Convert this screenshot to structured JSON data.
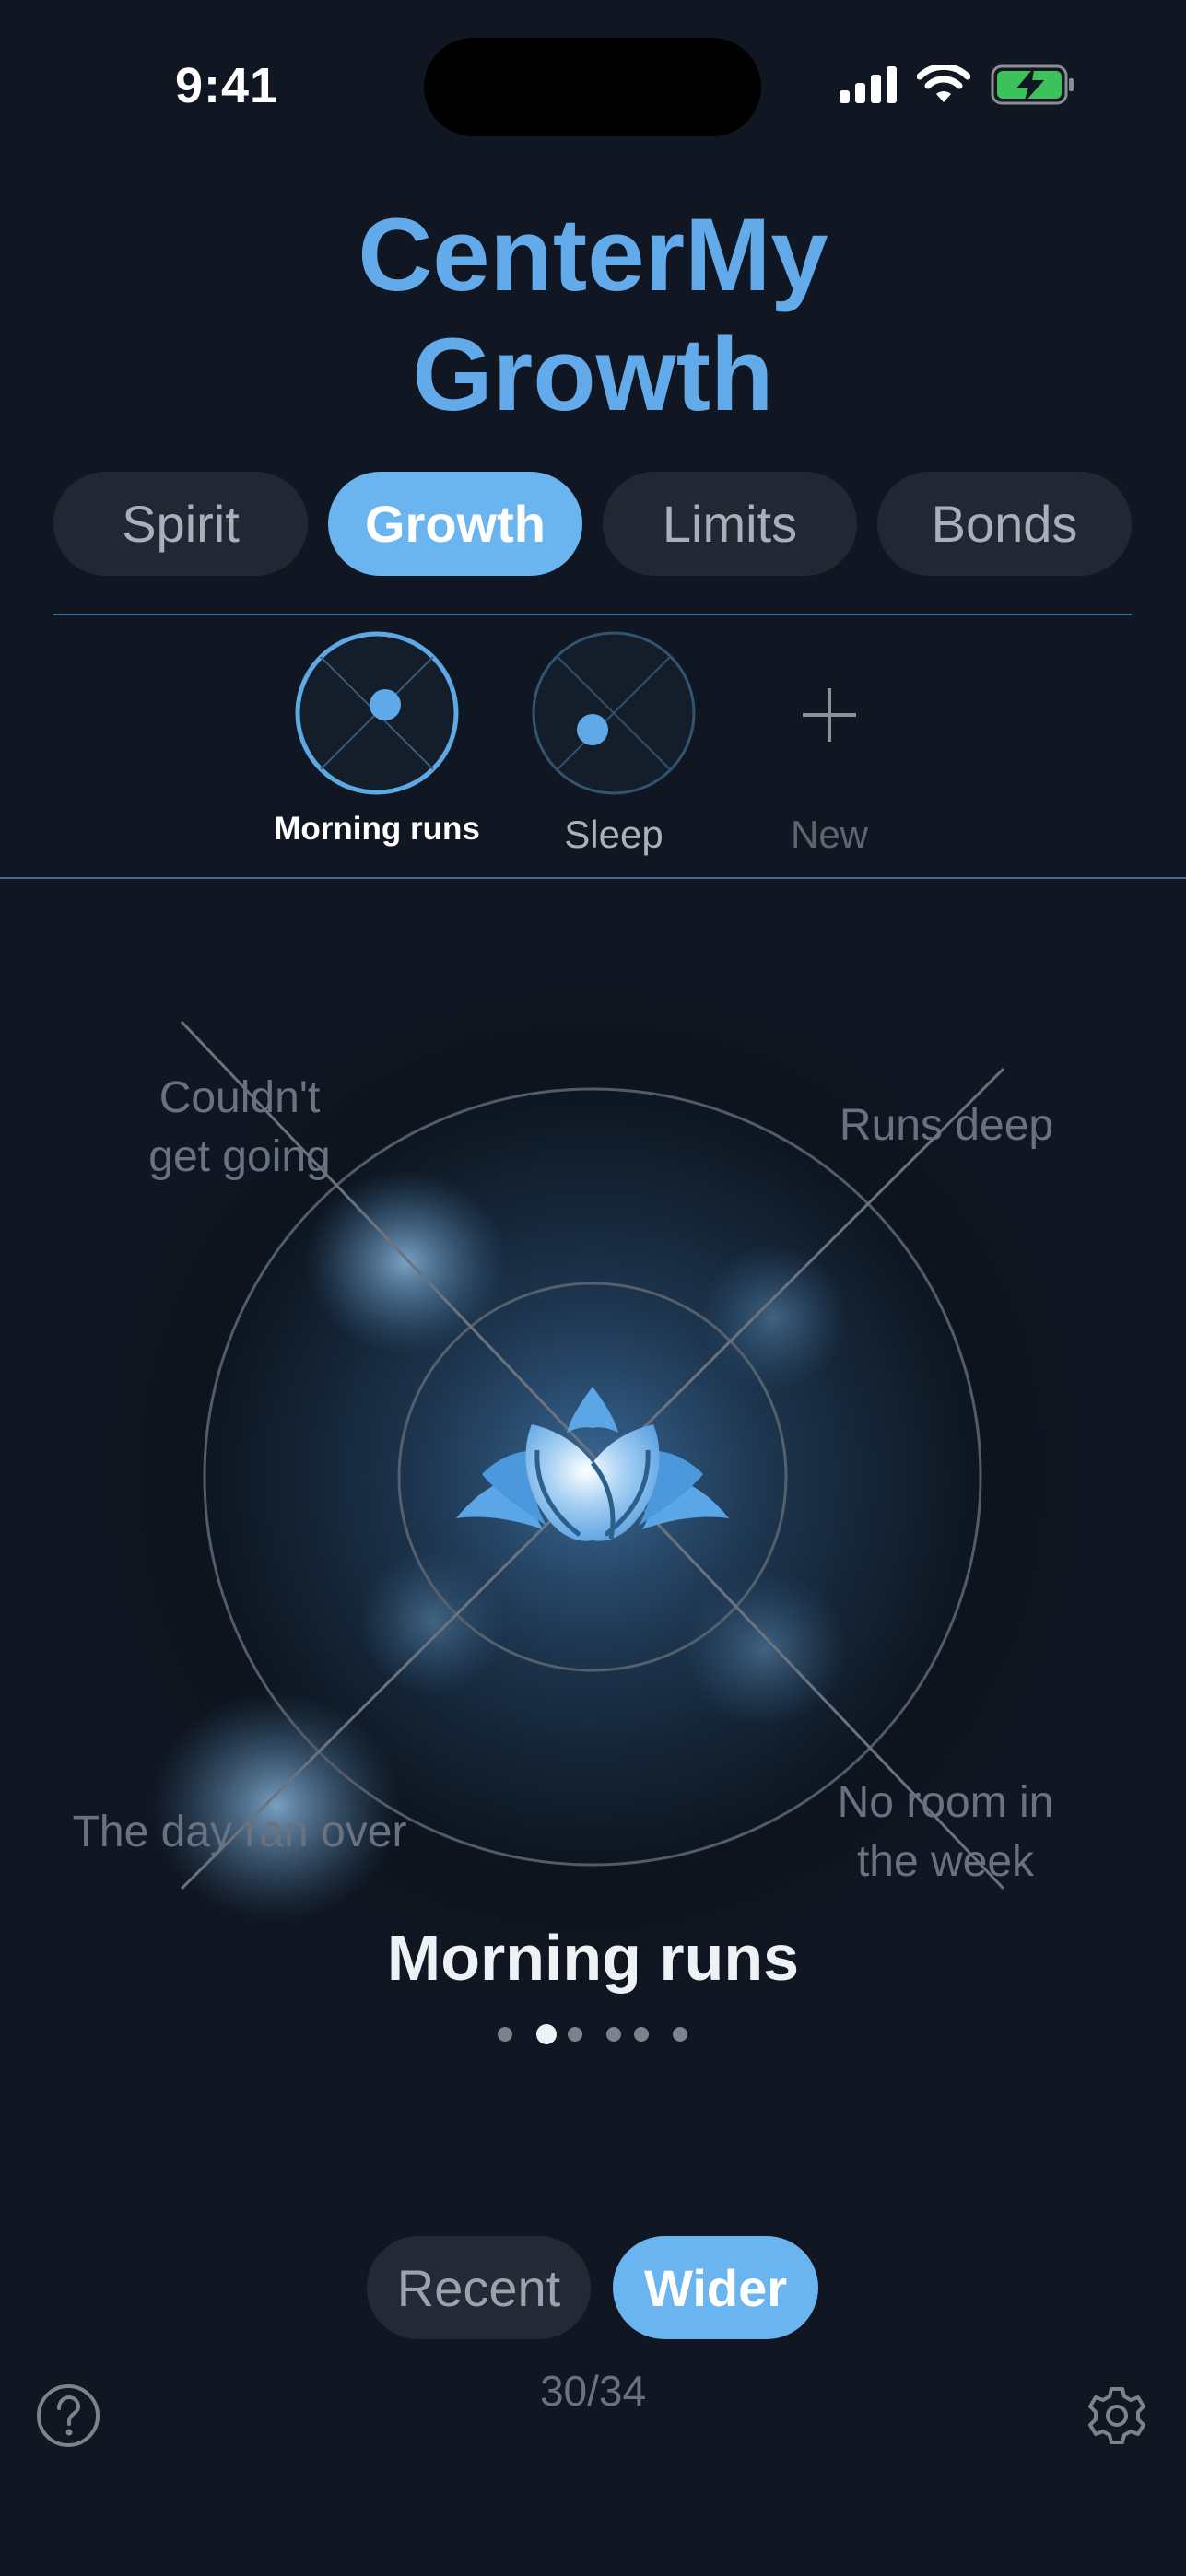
{
  "status_bar": {
    "time": "9:41"
  },
  "header": {
    "title_line1": "CenterMy",
    "title_line2": "Growth"
  },
  "tabs": [
    {
      "label": "Spirit",
      "active": false
    },
    {
      "label": "Growth",
      "active": true
    },
    {
      "label": "Limits",
      "active": false
    },
    {
      "label": "Bonds",
      "active": false
    }
  ],
  "habits": [
    {
      "label": "Morning runs",
      "selected": true
    },
    {
      "label": "Sleep",
      "selected": false
    },
    {
      "label": "New",
      "icon": "plus-icon"
    }
  ],
  "visual": {
    "center_icon": "lotus-icon",
    "quadrants": {
      "top_left_line1": "Couldn't",
      "top_left_line2": "get going",
      "top_right": "Runs deep",
      "bottom_left": "The day ran over",
      "bottom_right_line1": "No room in",
      "bottom_right_line2": "the week"
    }
  },
  "focus": {
    "title": "Morning runs",
    "page_count": 6,
    "active_page": 2
  },
  "view_toggle": {
    "recent_label": "Recent",
    "wider_label": "Wider",
    "selected": "Wider"
  },
  "progress_text": "30/34",
  "icons": {
    "help": "help-icon",
    "settings": "gear-icon"
  },
  "colors": {
    "accent": "#6ab4ef",
    "background": "#111722",
    "tab_inactive": "#222833"
  }
}
